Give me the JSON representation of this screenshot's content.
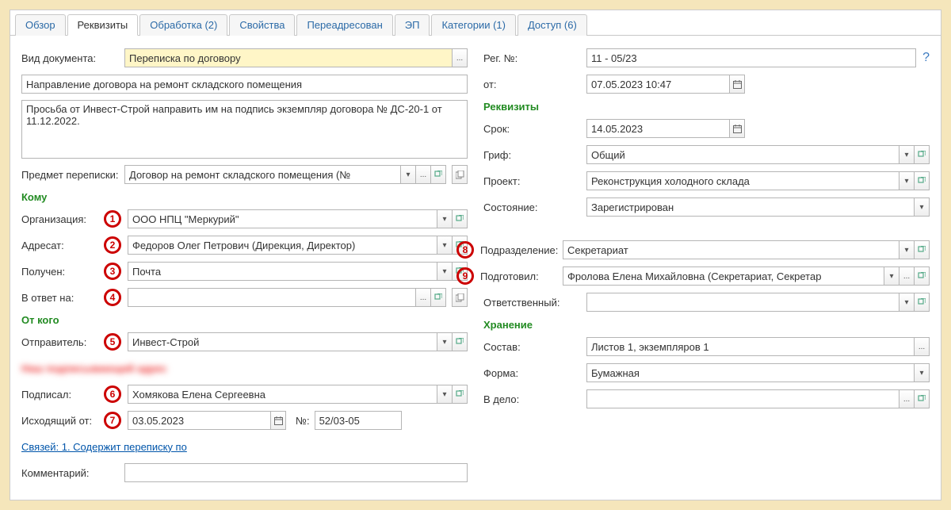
{
  "tabs": [
    {
      "label": "Обзор"
    },
    {
      "label": "Реквизиты"
    },
    {
      "label": "Обработка (2)"
    },
    {
      "label": "Свойства"
    },
    {
      "label": "Переадресован"
    },
    {
      "label": "ЭП"
    },
    {
      "label": "Категории (1)"
    },
    {
      "label": "Доступ (6)"
    }
  ],
  "left": {
    "doc_type_label": "Вид документа:",
    "doc_type_value": "Переписка по договору",
    "subject_value": "Направление договора на ремонт складского помещения",
    "body_value": "Просьба от Инвест-Строй направить им на подпись экземпляр договора № ДС-20-1 от 11.12.2022.",
    "corr_subject_label": "Предмет переписки:",
    "corr_subject_value": "Договор на ремонт складского помещения (№ ",
    "section_to": "Кому",
    "org_label": "Организация:",
    "org_value": "ООО НПЦ \"Меркурий\"",
    "addressee_label": "Адресат:",
    "addressee_value": "Федоров Олег Петрович (Дирекция, Директор)",
    "received_label": "Получен:",
    "received_value": "Почта",
    "in_reply_label": "В ответ на:",
    "in_reply_value": "",
    "section_from": "От кого",
    "sender_label": "Отправитель:",
    "sender_value": "Инвест-Строй",
    "blurred_text": "Наш подписывающий адрес",
    "signed_label": "Подписал:",
    "signed_value": "Хомякова Елена Сергеевна",
    "out_date_label": "Исходящий от:",
    "out_date_value": "03.05.2023",
    "out_num_label": "№:",
    "out_num_value": "52/03-05",
    "links_text": "Связей: 1. Содержит переписку по",
    "comment_label": "Комментарий:"
  },
  "right": {
    "regnum_label": "Рег. №:",
    "regnum_value": "11 - 05/23",
    "from_label": "от:",
    "from_value": "07.05.2023 10:47",
    "section_req": "Реквизиты",
    "deadline_label": "Срок:",
    "deadline_value": "14.05.2023",
    "grif_label": "Гриф:",
    "grif_value": "Общий",
    "project_label": "Проект:",
    "project_value": "Реконструкция холодного склада",
    "status_label": "Состояние:",
    "status_value": "Зарегистрирован",
    "dept_label": "Подразделение:",
    "dept_value": "Секретариат",
    "prepared_label": "Подготовил:",
    "prepared_value": "Фролова Елена Михайловна (Секретариат, Секретар",
    "responsible_label": "Ответственный:",
    "responsible_value": "",
    "section_storage": "Хранение",
    "composition_label": "Состав:",
    "composition_value": "Листов 1, экземпляров 1",
    "form_label": "Форма:",
    "form_value": "Бумажная",
    "in_case_label": "В дело:",
    "in_case_value": ""
  },
  "icons": {
    "dropdown": "▾",
    "ellipsis": "...",
    "calendar": "▦",
    "help": "?"
  },
  "badges": [
    "1",
    "2",
    "3",
    "4",
    "5",
    "6",
    "7",
    "8",
    "9"
  ]
}
